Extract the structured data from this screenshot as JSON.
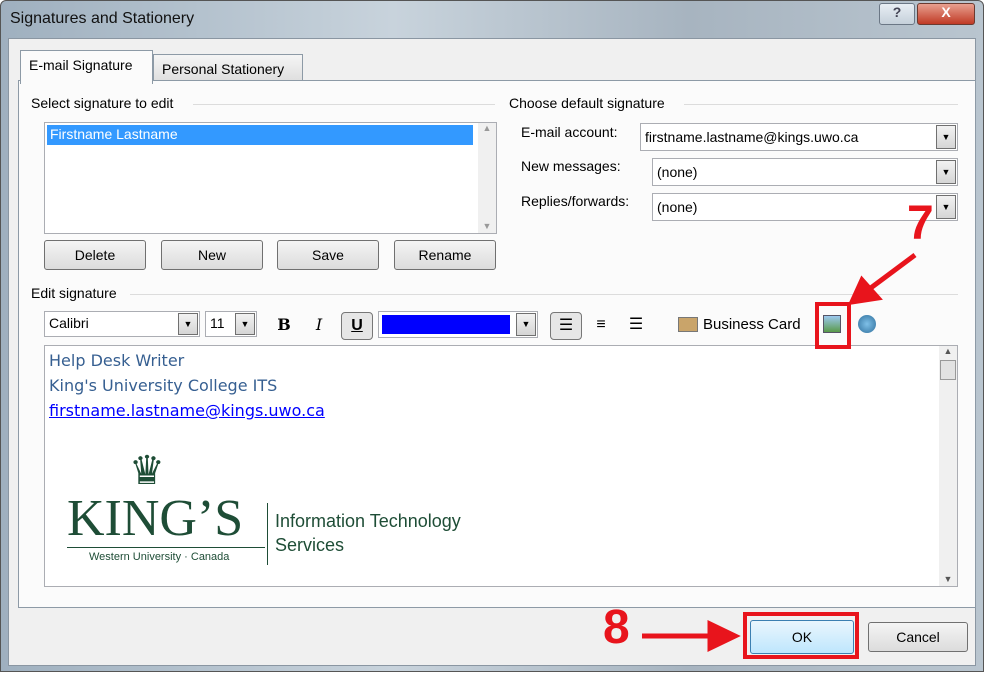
{
  "window": {
    "title": "Signatures and Stationery",
    "help": "?",
    "close": "X"
  },
  "tabs": [
    {
      "label": "E-mail Signature",
      "active": true
    },
    {
      "label": "Personal Stationery",
      "active": false
    }
  ],
  "select_signature": {
    "label": "Select signature to edit",
    "items": [
      "Firstname Lastname"
    ],
    "selected": "Firstname Lastname",
    "buttons": {
      "delete": "Delete",
      "new": "New",
      "save": "Save",
      "rename": "Rename"
    }
  },
  "default_signature": {
    "label": "Choose default signature",
    "email_account_label": "E-mail account:",
    "email_account": "firstname.lastname@kings.uwo.ca",
    "new_messages_label": "New messages:",
    "new_messages": "(none)",
    "replies_label": "Replies/forwards:",
    "replies": "(none)"
  },
  "edit_signature": {
    "label": "Edit signature",
    "font": "Calibri",
    "size": "11",
    "bold": "B",
    "italic": "I",
    "underline": "U",
    "color": "#0000ff",
    "business_card": "Business Card",
    "lines": [
      "Help Desk Writer",
      "King's University College ITS",
      "firstname.lastname@kings.uwo.ca"
    ],
    "logo": {
      "name": "KING'S",
      "sub": "Western University · Canada",
      "dept": "Information Technology Services",
      "color": "#1e4d36"
    }
  },
  "footer": {
    "ok": "OK",
    "cancel": "Cancel"
  },
  "annotations": {
    "step7": "7",
    "step8": "8",
    "color": "#e8141c"
  }
}
